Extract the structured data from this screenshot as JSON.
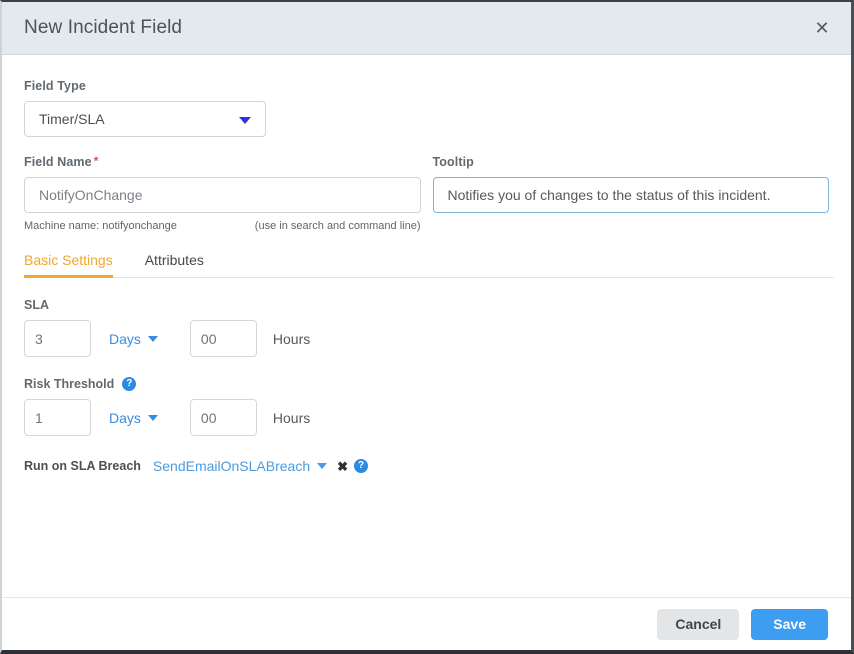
{
  "dialog": {
    "title": "New Incident Field",
    "close_icon": "close-icon"
  },
  "field_type": {
    "label": "Field Type",
    "value": "Timer/SLA"
  },
  "field_name": {
    "label": "Field Name",
    "required_marker": "*",
    "value": "NotifyOnChange",
    "placeholder": "NotifyOnChange",
    "machine_name": "Machine name: notifyonchange",
    "hint": "(use in search and command line)"
  },
  "tooltip": {
    "label": "Tooltip",
    "value": "Notifies you of changes to the status of this incident.",
    "placeholder": "Notifies you of changes to the status of this incident."
  },
  "tabs": [
    {
      "label": "Basic Settings",
      "active": true
    },
    {
      "label": "Attributes",
      "active": false
    }
  ],
  "sla": {
    "label": "SLA",
    "amount": "3",
    "unit": "Days",
    "hours_value": "00",
    "hours_label": "Hours"
  },
  "risk_threshold": {
    "label": "Risk Threshold",
    "help_icon": "help-icon",
    "amount": "1",
    "unit": "Days",
    "hours_value": "00",
    "hours_label": "Hours"
  },
  "run_on_breach": {
    "label": "Run on SLA Breach",
    "value": "SendEmailOnSLABreach",
    "clear_icon": "✖",
    "help_icon": "help-icon"
  },
  "footer": {
    "cancel_label": "Cancel",
    "save_label": "Save"
  },
  "colors": {
    "accent_tab": "#f0a730",
    "link_blue": "#3a8dde",
    "save_blue": "#3c9df1",
    "header_bg": "#e4e9ed",
    "required_red": "#d9534f",
    "help_blue": "#2e8ae0"
  }
}
